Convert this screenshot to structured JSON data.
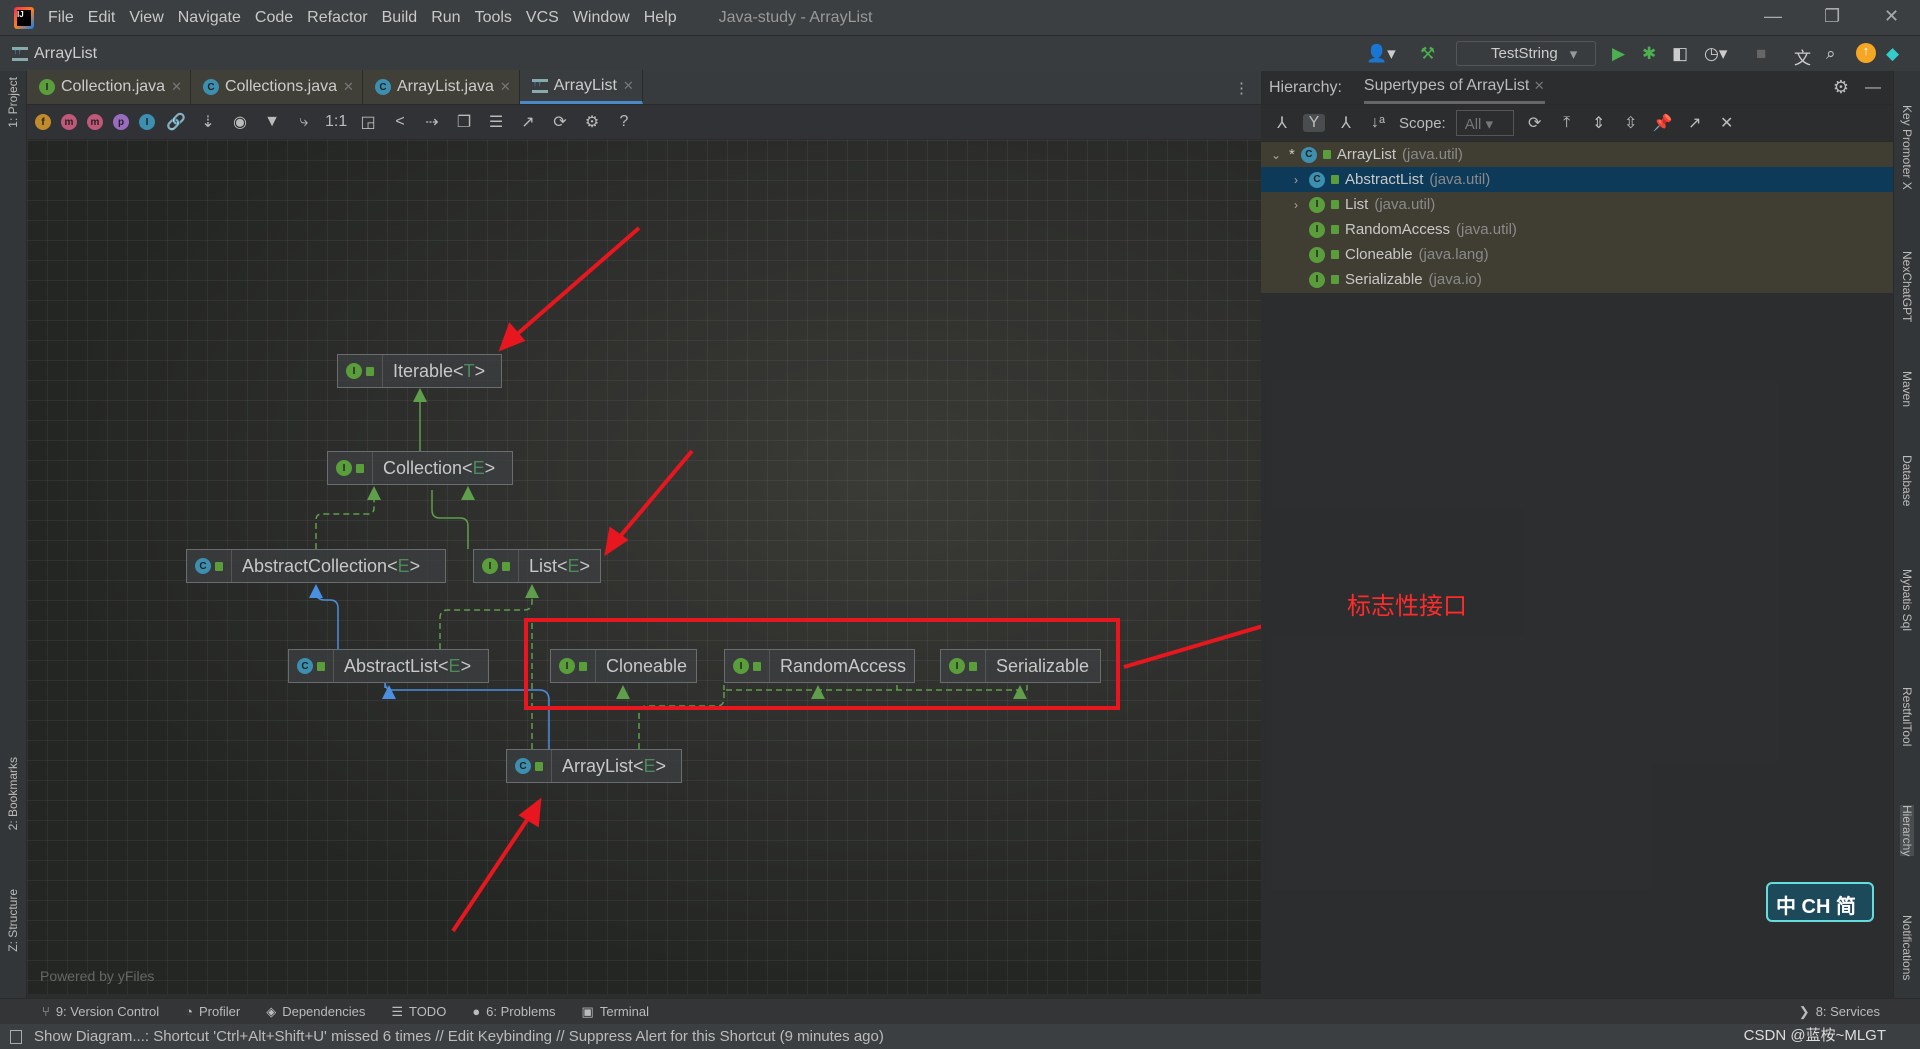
{
  "menu": [
    "File",
    "Edit",
    "View",
    "Navigate",
    "Code",
    "Refactor",
    "Build",
    "Run",
    "Tools",
    "VCS",
    "Window",
    "Help"
  ],
  "window_title": "Java-study - ArrayList",
  "breadcrumb": "ArrayList",
  "run_config": "TestString",
  "left_strip": [
    "1: Project",
    "2: Bookmarks",
    "Z: Structure"
  ],
  "right_strip": [
    "Key Promoter X",
    "NexChatGPT",
    "Maven",
    "Database",
    "Mybatis Sql",
    "RestfulTool",
    "Hierarchy",
    "Notifications"
  ],
  "tabs": [
    {
      "label": "Collection.java",
      "icon": "I",
      "kind": "interface"
    },
    {
      "label": "Collections.java",
      "icon": "C",
      "kind": "class"
    },
    {
      "label": "ArrayList.java",
      "icon": "C",
      "kind": "class"
    },
    {
      "label": "ArrayList",
      "icon": "hierarchy",
      "kind": "diagram",
      "active": true
    }
  ],
  "diagram_toolbar_icons": [
    "field",
    "constructor",
    "method",
    "property",
    "inner-class",
    "link",
    "sort",
    "eye",
    "filter",
    "route",
    "actual-size",
    "fit",
    "layout",
    "arrow",
    "copy",
    "export",
    "expand",
    "refresh",
    "gear",
    "help"
  ],
  "diagram": {
    "nodes": {
      "iterable": {
        "name": "Iterable<",
        "tp": "T",
        "end": ">",
        "kind": "interface"
      },
      "collection": {
        "name": "Collection<",
        "tp": "E",
        "end": ">",
        "kind": "interface"
      },
      "abstract_collection": {
        "name": "AbstractCollection<",
        "tp": "E",
        "end": ">",
        "kind": "abstract"
      },
      "list": {
        "name": "List<",
        "tp": "E",
        "end": ">",
        "kind": "interface"
      },
      "abstract_list": {
        "name": "AbstractList<",
        "tp": "E",
        "end": ">",
        "kind": "abstract"
      },
      "cloneable": {
        "name": "Cloneable",
        "tp": "",
        "end": "",
        "kind": "interface"
      },
      "random_access": {
        "name": "RandomAccess",
        "tp": "",
        "end": "",
        "kind": "interface"
      },
      "serializable": {
        "name": "Serializable",
        "tp": "",
        "end": "",
        "kind": "interface"
      },
      "arraylist": {
        "name": "ArrayList<",
        "tp": "E",
        "end": ">",
        "kind": "class"
      }
    },
    "annotation": "标志性接口",
    "powered_by": "Powered by yFiles",
    "colors": {
      "implements": "#5f9e4a",
      "extends": "#4a8fe0",
      "highlight": "#e8161e"
    }
  },
  "hierarchy": {
    "label": "Hierarchy:",
    "tab": "Supertypes of ArrayList",
    "scope_label": "Scope:",
    "scope_value": "All",
    "rows": [
      {
        "name": "ArrayList",
        "pkg": "(java.util)",
        "icon": "C",
        "expander": "v",
        "star": "*"
      },
      {
        "name": "AbstractList",
        "pkg": "(java.util)",
        "icon": "C",
        "expander": ">",
        "selected": true
      },
      {
        "name": "List",
        "pkg": "(java.util)",
        "icon": "I",
        "expander": ">"
      },
      {
        "name": "RandomAccess",
        "pkg": "(java.util)",
        "icon": "I",
        "expander": ""
      },
      {
        "name": "Cloneable",
        "pkg": "(java.lang)",
        "icon": "I",
        "expander": ""
      },
      {
        "name": "Serializable",
        "pkg": "(java.io)",
        "icon": "I",
        "expander": ""
      }
    ]
  },
  "bottom_tools": [
    {
      "label": "9: Version Control",
      "icon": "⑂"
    },
    {
      "label": "Profiler",
      "icon": "◔"
    },
    {
      "label": "Dependencies",
      "icon": "◈"
    },
    {
      "label": "TODO",
      "icon": "☰"
    },
    {
      "label": "6: Problems",
      "icon": "●"
    },
    {
      "label": "Terminal",
      "icon": "▣"
    }
  ],
  "services": "8: Services",
  "status": "Show Diagram...: Shortcut 'Ctrl+Alt+Shift+U' missed 6 times // Edit Keybinding // Suppress Alert for this Shortcut (9 minutes ago)",
  "ime": "中 CH 简",
  "watermark": "CSDN @蓝桉~MLGT"
}
